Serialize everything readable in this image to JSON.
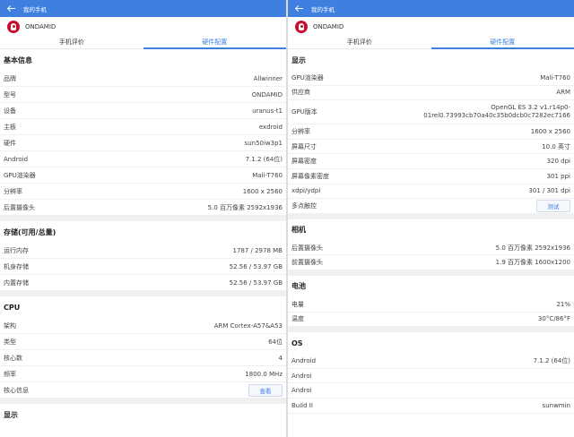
{
  "left": {
    "appbar_title": "我的手机",
    "device_name": "ONDAMID",
    "tabs": [
      {
        "label": "手机评价",
        "active": false
      },
      {
        "label": "硬件配置",
        "active": true
      }
    ],
    "sections": [
      {
        "title": "基本信息",
        "rows": [
          {
            "label": "品牌",
            "value": "Allwinner"
          },
          {
            "label": "型号",
            "value": "ONDAMID"
          },
          {
            "label": "设备",
            "value": "uranus-t1"
          },
          {
            "label": "主板",
            "value": "exdroid"
          },
          {
            "label": "硬件",
            "value": "sun50iw3p1"
          },
          {
            "label": "Android",
            "value": "7.1.2 (64位)"
          },
          {
            "label": "GPU渲染器",
            "value": "Mali-T760"
          },
          {
            "label": "分辨率",
            "value": "1600 x 2560"
          },
          {
            "label": "后置摄像头",
            "value": "5.0 百万像素 2592x1936"
          }
        ]
      },
      {
        "title": "存储(可用/总量)",
        "rows": [
          {
            "label": "运行内存",
            "value": "1787 / 2978 MB"
          },
          {
            "label": "机身存储",
            "value": "52.56 / 53.97 GB"
          },
          {
            "label": "内置存储",
            "value": "52.56 / 53.97 GB"
          }
        ]
      },
      {
        "title": "CPU",
        "rows": [
          {
            "label": "架构",
            "value": "ARM Cortex-A57&A53"
          },
          {
            "label": "类型",
            "value": "64位"
          },
          {
            "label": "核心数",
            "value": "4"
          },
          {
            "label": "频率",
            "value": "1800.0 MHz"
          },
          {
            "label": "核心信息",
            "button": "查看"
          }
        ]
      }
    ],
    "trailing_section_title": "显示"
  },
  "right": {
    "appbar_title": "我的手机",
    "device_name": "ONDAMID",
    "tabs": [
      {
        "label": "手机评价",
        "active": false
      },
      {
        "label": "硬件配置",
        "active": true
      }
    ],
    "sections": [
      {
        "title": "显示",
        "rows": [
          {
            "label": "GPU渲染器",
            "value": "Mali-T760"
          },
          {
            "label": "供应商",
            "value": "ARM"
          },
          {
            "label": "GPU版本",
            "value": "OpenGL ES 3.2 v1.r14p0-01rel0.73993cb70a40c35b0dcb0c7282ec7166"
          },
          {
            "label": "分辨率",
            "value": "1600 x 2560"
          },
          {
            "label": "屏幕尺寸",
            "value": "10.0 英寸"
          },
          {
            "label": "屏幕密度",
            "value": "320 dpi"
          },
          {
            "label": "屏幕像素密度",
            "value": "301 ppi"
          },
          {
            "label": "xdpi/ydpi",
            "value": "301 / 301 dpi"
          },
          {
            "label": "多点触控",
            "button": "测试"
          }
        ]
      },
      {
        "title": "相机",
        "rows": [
          {
            "label": "后置摄像头",
            "value": "5.0 百万像素 2592x1936"
          },
          {
            "label": "前置摄像头",
            "value": "1.9 百万像素 1600x1200"
          }
        ]
      },
      {
        "title": "电池",
        "rows": [
          {
            "label": "电量",
            "value": "21%"
          },
          {
            "label": "温度",
            "value": "30°C/86°F"
          }
        ]
      },
      {
        "title": "OS",
        "rows": [
          {
            "label": "Android",
            "value": "7.1.2 (64位)"
          },
          {
            "label": "Androi",
            "value": ""
          },
          {
            "label": "Androi",
            "value": ""
          },
          {
            "label": "Build II",
            "value": "sunwmin"
          }
        ]
      }
    ]
  },
  "colors": {
    "accent": "#3f7fe0",
    "section_gap": "#f0f0f0",
    "logo": "#c8102e"
  },
  "icons": {
    "back": "arrow-left-icon",
    "logo": "antutu-logo-icon"
  }
}
